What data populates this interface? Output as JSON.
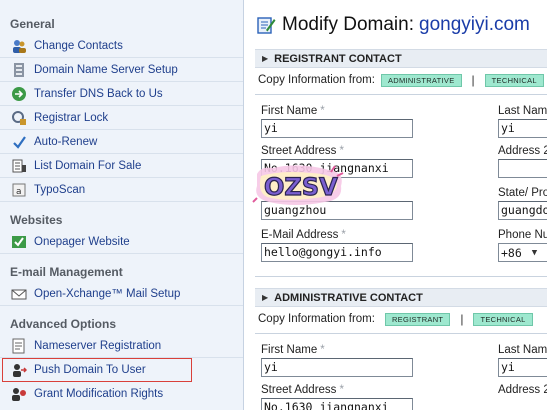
{
  "sidebar": {
    "sections": [
      {
        "title": "General",
        "items": [
          {
            "label": "Change Contacts",
            "icon": "contacts-icon"
          },
          {
            "label": "Domain Name Server Setup",
            "icon": "server-icon"
          },
          {
            "label": "Transfer DNS Back to Us",
            "icon": "transfer-icon"
          },
          {
            "label": "Registrar Lock",
            "icon": "lock-icon"
          },
          {
            "label": "Auto-Renew",
            "icon": "auto-renew-icon"
          },
          {
            "label": "List Domain For Sale",
            "icon": "sale-list-icon"
          },
          {
            "label": "TypoScan",
            "icon": "typoscan-icon"
          }
        ]
      },
      {
        "title": "Websites",
        "items": [
          {
            "label": "Onepager Website",
            "icon": "checkmark-icon"
          }
        ]
      },
      {
        "title": "E-mail Management",
        "items": [
          {
            "label": "Open-Xchange™ Mail Setup",
            "icon": "mail-icon"
          }
        ]
      },
      {
        "title": "Advanced Options",
        "items": [
          {
            "label": "Nameserver Registration",
            "icon": "nameserver-icon"
          },
          {
            "label": "Push Domain To User",
            "icon": "push-user-icon"
          },
          {
            "label": "Grant Modification Rights",
            "icon": "grant-rights-icon"
          }
        ]
      }
    ]
  },
  "main": {
    "title": "Modify Domain:",
    "domain": "gongyiyi.com",
    "registrant": {
      "heading": "REGISTRANT CONTACT",
      "copy_label": "Copy Information from:",
      "copy_buttons": [
        "ADMINISTRATIVE",
        "TECHNICAL"
      ],
      "separator": "|",
      "first_name_label": "First Name",
      "first_name_value": "yi",
      "last_name_label": "Last Name",
      "last_name_value": "yi",
      "street_label": "Street Address",
      "street_value": "No.1630 jiangnanxi",
      "address2_label": "Address 2",
      "address2_value": "",
      "city_value": "guangzhou",
      "state_label": "State/ Province",
      "state_value": "guangdong",
      "email_label": "E-Mail Address",
      "email_value": "hello@gongyi.info",
      "phone_label": "Phone Number",
      "phone_code": "+86"
    },
    "administrative": {
      "heading": "ADMINISTRATIVE CONTACT",
      "copy_label": "Copy Information from:",
      "copy_buttons": [
        "REGISTRANT",
        "TECHNICAL"
      ],
      "separator": "|",
      "first_name_label": "First Name",
      "first_name_value": "yi",
      "last_name_label": "Last Name",
      "last_name_value": "yi",
      "street_label": "Street Address",
      "street_value": "No.1630 jiangnanxi",
      "address2_label": "Address 2"
    },
    "required_mark": "*",
    "watermark_text": "OZSV"
  },
  "colors": {
    "sidebar_bg": "#eef3fa",
    "link": "#1f3f8c",
    "pill": "#9ee8cf",
    "highlight_border": "#d9403a",
    "domain_text": "#1a3ca8"
  }
}
